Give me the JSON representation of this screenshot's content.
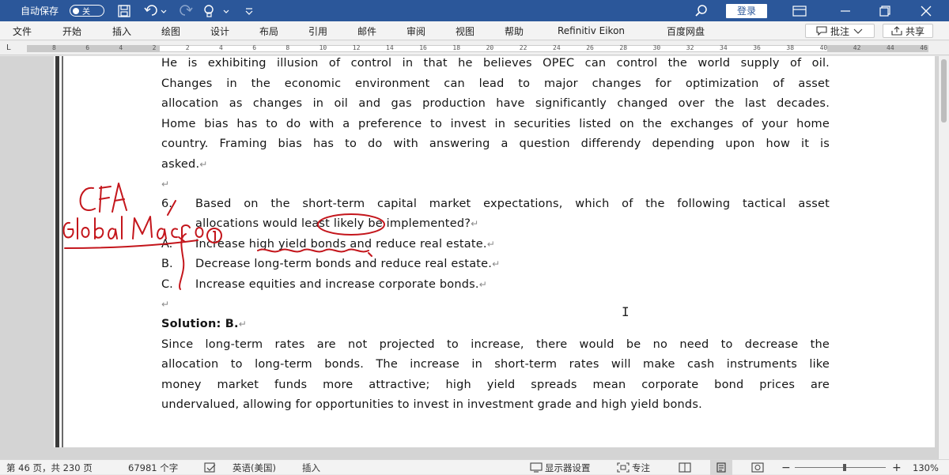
{
  "titlebar": {
    "autosave_label": "自动保存",
    "autosave_state": "关",
    "login_label": "登录"
  },
  "menubar": {
    "tabs": [
      "文件",
      "开始",
      "插入",
      "绘图",
      "设计",
      "布局",
      "引用",
      "邮件",
      "审阅",
      "视图",
      "帮助",
      "Refinitiv Eikon",
      "百度网盘"
    ],
    "comment_label": "批注",
    "share_label": "共享"
  },
  "ruler": {
    "corner": "L",
    "numbers": [
      "8",
      "6",
      "4",
      "2",
      "2",
      "4",
      "6",
      "8",
      "10",
      "12",
      "14",
      "16",
      "18",
      "20",
      "22",
      "24",
      "26",
      "28",
      "30",
      "32",
      "34",
      "36",
      "38",
      "40",
      "42",
      "44",
      "46"
    ]
  },
  "document": {
    "lines_top": [
      "He is exhibiting illusion of control in that he believes OPEC can control the world supply of oil.",
      "Changes in the economic environment can lead to major changes for optimization of asset",
      "allocation as changes in oil and gas production have significantly changed over the last decades.",
      "Home bias has to do with a preference to invest in securities listed on the exchanges of your home",
      "country. Framing bias has to do with answering a question differendy depending upon how it is",
      "asked."
    ],
    "question": {
      "number": "6.",
      "line1": "Based on the short-term capital market expectations, which of the following tactical asset",
      "line2": "allocations would least likely be implemented?"
    },
    "options": [
      {
        "letter": "A.",
        "text": "Increase high yield bonds and reduce real estate."
      },
      {
        "letter": "B.",
        "text": "Decrease long-term bonds and reduce real estate."
      },
      {
        "letter": "C.",
        "text": "Increase equities and increase corporate bonds."
      }
    ],
    "solution_label": "Solution: B.",
    "solution_lines": [
      "Since long-term rates are not projected to increase, there would be no need to decrease the",
      "allocation to long-term bonds. The increase in short-term rates will make cash instruments like",
      "money market funds more attractive; high yield spreads mean corporate bond prices are",
      "undervalued, allowing for opportunities to invest in investment grade and high yield bonds."
    ],
    "paragraph_mark": "↵"
  },
  "handwriting": {
    "note1": "CFA",
    "note2": "Global Macro",
    "circled_number": "1"
  },
  "statusbar": {
    "page": "第 46 页，共 230 页",
    "words": "67981 个字",
    "language": "英语(美国)",
    "mode": "插入",
    "display_settings": "显示器设置",
    "focus": "专注",
    "zoom": "130%"
  }
}
